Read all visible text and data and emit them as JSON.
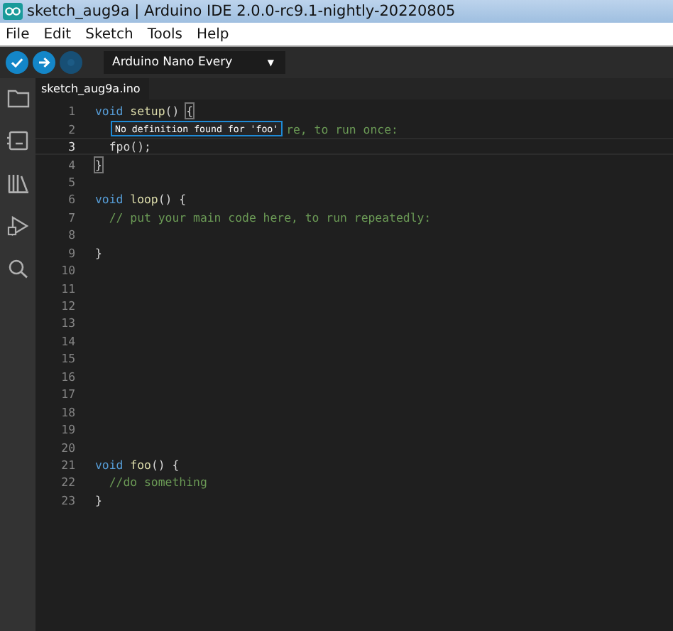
{
  "window": {
    "title": "sketch_aug9a | Arduino IDE 2.0.0-rc9.1-nightly-20220805"
  },
  "menu": [
    "File",
    "Edit",
    "Sketch",
    "Tools",
    "Help"
  ],
  "toolbar": {
    "buttons": [
      {
        "kind": "verify",
        "disabled": false
      },
      {
        "kind": "upload",
        "disabled": false
      },
      {
        "kind": "debug",
        "disabled": true
      }
    ],
    "board": {
      "value": "Arduino Nano Every",
      "caret": "▼"
    }
  },
  "sidebar": [
    {
      "kind": "folder"
    },
    {
      "kind": "board"
    },
    {
      "kind": "library"
    },
    {
      "kind": "debug"
    },
    {
      "kind": "search"
    }
  ],
  "tab": {
    "label": "sketch_aug9a.ino"
  },
  "lines": [
    {
      "number": "1",
      "current": false,
      "tokens": [
        {
          "text": "void",
          "kind": "keyword"
        },
        {
          "text": "setup",
          "kind": "function"
        },
        {
          "text": "() ",
          "kind": "plain"
        },
        {
          "text": "{",
          "kind": "bracket"
        }
      ]
    },
    {
      "number": "2",
      "current": false,
      "tooltip": {
        "text": "No definition found for 'foo'"
      },
      "tokens": [
        {
          "text": "re, to run once:",
          "kind": "comment"
        }
      ]
    },
    {
      "number": "3",
      "current": true,
      "tokens": [
        {
          "text": "  fpo();",
          "kind": "plain"
        }
      ]
    },
    {
      "number": "4",
      "current": false,
      "tokens": [
        {
          "text": "}",
          "kind": "bracket"
        }
      ]
    },
    {
      "number": "5",
      "current": false
    },
    {
      "number": "6",
      "current": false,
      "tokens": [
        {
          "text": "void",
          "kind": "keyword"
        },
        {
          "text": "loop",
          "kind": "function"
        },
        {
          "text": "() {",
          "kind": "plain"
        }
      ]
    },
    {
      "number": "7",
      "current": false,
      "tokens": [
        {
          "text": "  // put your main code here, to run repeatedly:",
          "kind": "comment"
        }
      ]
    },
    {
      "number": "8",
      "current": false
    },
    {
      "number": "9",
      "current": false,
      "tokens": [
        {
          "text": "}",
          "kind": "plain"
        }
      ]
    },
    {
      "number": "10",
      "current": false
    },
    {
      "number": "11",
      "current": false
    },
    {
      "number": "12",
      "current": false
    },
    {
      "number": "13",
      "current": false
    },
    {
      "number": "14",
      "current": false
    },
    {
      "number": "15",
      "current": false
    },
    {
      "number": "16",
      "current": false
    },
    {
      "number": "17",
      "current": false
    },
    {
      "number": "18",
      "current": false
    },
    {
      "number": "19",
      "current": false
    },
    {
      "number": "20",
      "current": false
    },
    {
      "number": "21",
      "current": false,
      "tokens": [
        {
          "text": "void",
          "kind": "keyword"
        },
        {
          "text": "foo",
          "kind": "function"
        },
        {
          "text": "() {",
          "kind": "plain"
        }
      ]
    },
    {
      "number": "22",
      "current": false,
      "tokens": [
        {
          "text": "  //do something",
          "kind": "comment"
        }
      ]
    },
    {
      "number": "23",
      "current": false,
      "tokens": [
        {
          "text": "}",
          "kind": "plain"
        }
      ]
    }
  ]
}
